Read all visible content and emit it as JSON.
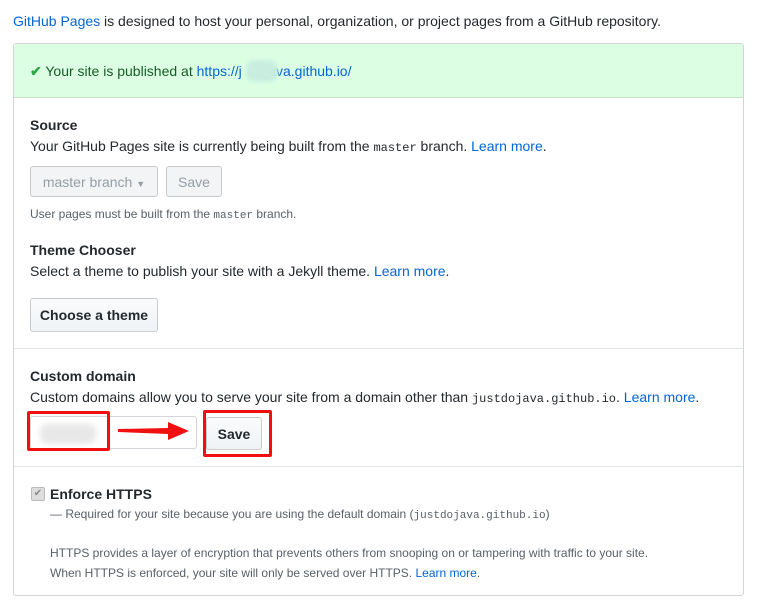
{
  "intro": {
    "link": "GitHub Pages",
    "text": " is designed to host your personal, organization, or project pages from a GitHub repository."
  },
  "flash": {
    "text": "Your site is published at ",
    "url": "https://j      java.github.io/"
  },
  "source": {
    "title": "Source",
    "desc_pre": "Your GitHub Pages site is currently being built from the ",
    "branch": "master",
    "desc_post": " branch. ",
    "learn": "Learn more",
    "dot": ".",
    "select": "master branch",
    "save": "Save",
    "note_pre": "User pages must be built from the ",
    "note_post": " branch."
  },
  "theme": {
    "title": "Theme Chooser",
    "desc": "Select a theme to publish your site with a Jekyll theme. ",
    "learn": "Learn more",
    "dot": ".",
    "button": "Choose a theme"
  },
  "domain": {
    "title": "Custom domain",
    "desc": "Custom domains allow you to serve your site from a domain other than ",
    "domain": "justdojava.github.io",
    "dot": ". ",
    "learn": "Learn more",
    "dot2": ".",
    "input_value": "",
    "save": "Save"
  },
  "https": {
    "title": "Enforce HTTPS",
    "checked": true,
    "req_pre": "— Required for your site because you are using the default domain (",
    "req_domain": "justdojava.github.io",
    "req_post": ")",
    "line1": "HTTPS provides a layer of encryption that prevents others from snooping on or tampering with traffic to your site.",
    "line2": "When HTTPS is enforced, your site will only be served over HTTPS. ",
    "learn": "Learn more",
    "dot": "."
  },
  "colors": {
    "annotation": "#f01010",
    "link": "#0366d6",
    "success": "#dcffe4"
  }
}
